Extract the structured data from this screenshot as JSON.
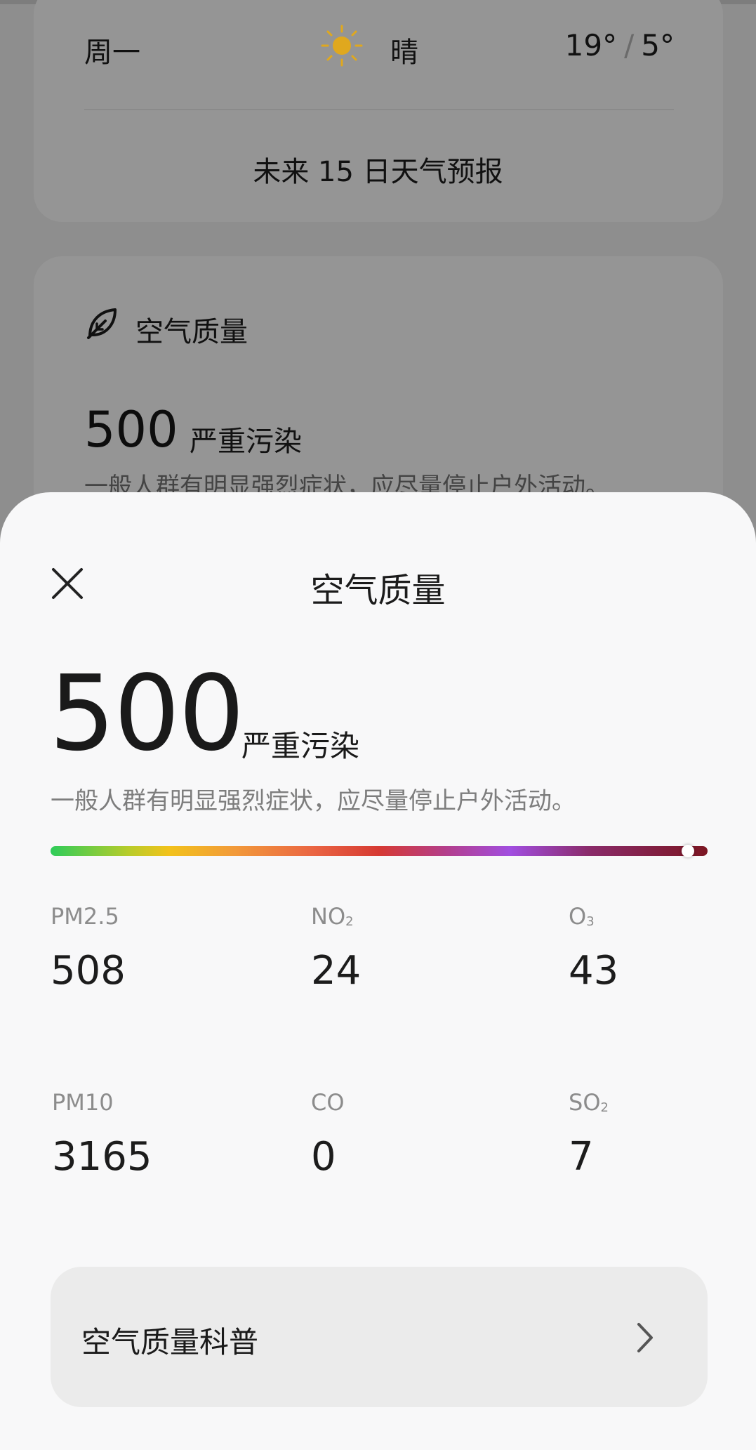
{
  "background": {
    "forecast": {
      "day": "周一",
      "condition": "晴",
      "temp_high": "19°",
      "temp_separator": "/",
      "temp_low": "5°",
      "link_label": "未来 15 日天气预报",
      "sun_icon": "sun-icon",
      "sun_color": "#e0a81e"
    },
    "air_card": {
      "title": "空气质量",
      "value": "500",
      "level": "严重污染",
      "description": "一般人群有明显强烈症状，应尽量停止户外活动。",
      "icon": "leaf-icon"
    }
  },
  "sheet": {
    "title": "空气质量",
    "close_icon": "close-icon",
    "aqi_value": "500",
    "aqi_level": "严重污染",
    "aqi_description": "一般人群有明显强烈症状，应尽量停止户外活动。",
    "aqi_scale_position": 0.97,
    "pollutants": [
      {
        "name": "PM2.5",
        "sub": "",
        "value": "508"
      },
      {
        "name": "NO",
        "sub": "2",
        "value": "24"
      },
      {
        "name": "O",
        "sub": "3",
        "value": "43"
      },
      {
        "name": "PM10",
        "sub": "",
        "value": "3165"
      },
      {
        "name": "CO",
        "sub": "",
        "value": "0"
      },
      {
        "name": "SO",
        "sub": "2",
        "value": "7"
      }
    ],
    "info_button": {
      "label": "空气质量科普",
      "icon": "chevron-right-icon"
    }
  },
  "colors": {
    "sheet_background": "#f8f8f9",
    "overlay": "#8e8e8e",
    "info_button_background": "#ebebeb"
  }
}
